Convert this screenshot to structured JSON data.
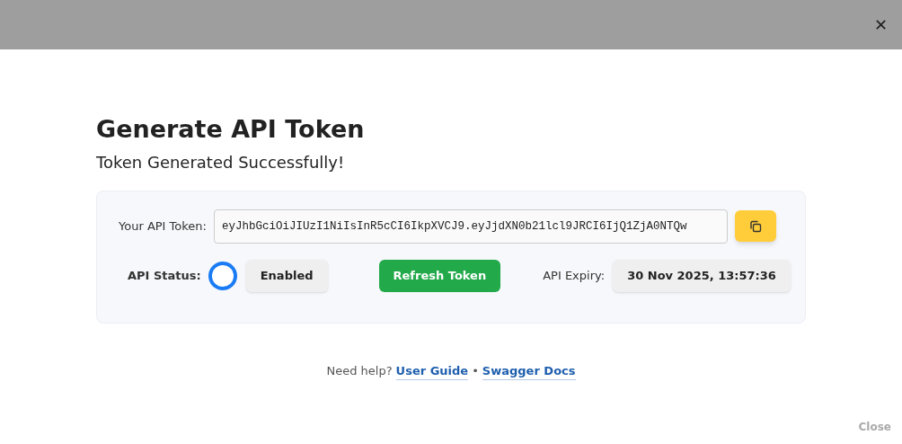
{
  "header": {
    "close_icon": "✕"
  },
  "title": "Generate API Token",
  "subtitle": "Token Generated Successfully!",
  "token": {
    "label": "Your API Token:",
    "value": "eyJhbGciOiJIUzI1NiIsInR5cCI6IkpXVCJ9.eyJjdXN0b21lcl9JRCI6IjQ1ZjA0NTQw"
  },
  "status": {
    "label": "API Status:",
    "on": true,
    "value": "Enabled"
  },
  "refresh_button": "Refresh Token",
  "expiry": {
    "label": "API Expiry:",
    "value": "30 Nov 2025, 13:57:36"
  },
  "help": {
    "text": "Need help?",
    "links": [
      "User Guide",
      "Swagger Docs"
    ],
    "separator": "•"
  },
  "footer_button": "Close"
}
